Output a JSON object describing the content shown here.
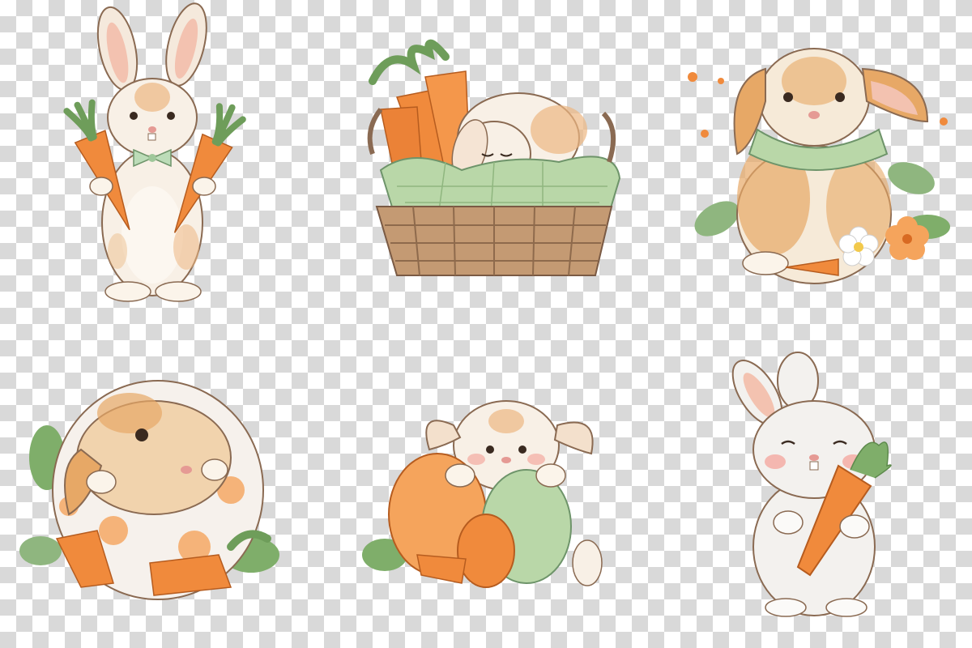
{
  "canvas": {
    "background": "transparency-checkerboard",
    "checker_colors": [
      "#ffffff",
      "#d9d9d9"
    ]
  },
  "illustrations": [
    {
      "id": "bunny-bowtie-carrots",
      "style": "watercolor",
      "subject": "bunny"
    },
    {
      "id": "bunny-sleeping-basket",
      "style": "watercolor",
      "subject": "bunny"
    },
    {
      "id": "bunny-lop-scarf-flowers",
      "style": "watercolor",
      "subject": "bunny"
    },
    {
      "id": "bunny-in-egg",
      "style": "watercolor",
      "subject": "bunny"
    },
    {
      "id": "bunny-with-eggs",
      "style": "watercolor",
      "subject": "bunny"
    },
    {
      "id": "bunny-white-carrot",
      "style": "watercolor",
      "subject": "bunny"
    }
  ],
  "palette": {
    "fur_cream": "#f7efe4",
    "fur_orange": "#e7a866",
    "carrot": "#f08a3c",
    "carrot_dark": "#d86a22",
    "leaf_green": "#7fae6a",
    "mint": "#b9d7a8",
    "basket": "#b8906a",
    "blush": "#f4a9a0",
    "outline": "#7a5a44"
  }
}
